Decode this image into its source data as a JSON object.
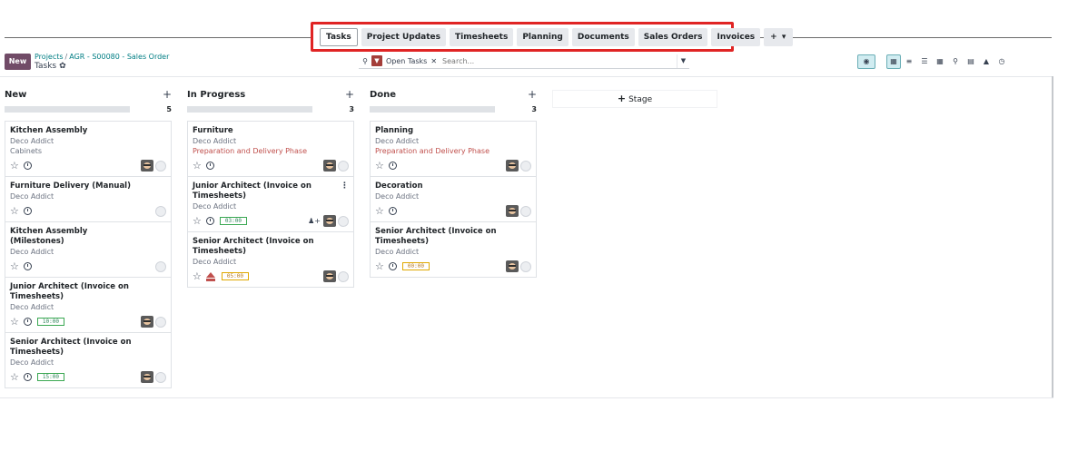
{
  "tabs": [
    {
      "label": "Tasks",
      "active": true
    },
    {
      "label": "Project Updates"
    },
    {
      "label": "Timesheets"
    },
    {
      "label": "Planning"
    },
    {
      "label": "Documents"
    },
    {
      "label": "Sales Orders"
    },
    {
      "label": "Invoices"
    },
    {
      "label": "+ ▾"
    }
  ],
  "control": {
    "new_label": "New",
    "breadcrumb_root": "Projects",
    "breadcrumb_sep": "/",
    "breadcrumb_current": "AGR - S00080 - Sales Order",
    "page_title": "Tasks",
    "gear": "✿"
  },
  "search": {
    "facet_label": "Open Tasks",
    "facet_remove": "✕",
    "placeholder": "Search...",
    "dropdown": "▼"
  },
  "views": [
    "▦",
    "≡",
    "☰",
    "▦",
    "⚲",
    "▤",
    "▲",
    "◷"
  ],
  "columns": [
    {
      "title": "New",
      "add": "+",
      "count": "5",
      "cards": [
        {
          "title": "Kitchen Assembly",
          "lines": [
            {
              "text": "Deco Addict"
            },
            {
              "text": "Cabinets"
            }
          ],
          "avatar": true,
          "badge": null
        },
        {
          "title": "Furniture Delivery (Manual)",
          "lines": [
            {
              "text": "Deco Addict"
            }
          ],
          "avatar": false,
          "badge": null
        },
        {
          "title": "Kitchen Assembly (Milestones)",
          "lines": [
            {
              "text": "Deco Addict"
            }
          ],
          "avatar": false,
          "badge": null
        },
        {
          "title": "Junior Architect (Invoice on Timesheets)",
          "lines": [
            {
              "text": "Deco Addict"
            }
          ],
          "avatar": true,
          "badge": "10:00"
        },
        {
          "title": "Senior Architect (Invoice on Timesheets)",
          "lines": [
            {
              "text": "Deco Addict"
            }
          ],
          "avatar": true,
          "badge": "15:00"
        }
      ]
    },
    {
      "title": "In Progress",
      "add": "+",
      "count": "3",
      "cards": [
        {
          "title": "Furniture",
          "lines": [
            {
              "text": "Deco Addict"
            },
            {
              "text": "Preparation and Delivery Phase",
              "red": true
            }
          ],
          "avatar": true,
          "badge": null
        },
        {
          "title": "Junior Architect (Invoice on Timesheets)",
          "lines": [
            {
              "text": "Deco Addict"
            }
          ],
          "avatar": true,
          "badge": "03:00",
          "kebab": true,
          "users": true
        },
        {
          "title": "Senior Architect (Invoice on Timesheets)",
          "lines": [
            {
              "text": "Deco Addict"
            }
          ],
          "avatar": true,
          "badge": "05:00",
          "badge_warn": true,
          "alert": true
        }
      ]
    },
    {
      "title": "Done",
      "add": "+",
      "count": "3",
      "cards": [
        {
          "title": "Planning",
          "lines": [
            {
              "text": "Deco Addict"
            },
            {
              "text": "Preparation and Delivery Phase",
              "red": true
            }
          ],
          "avatar": true,
          "badge": null
        },
        {
          "title": "Decoration",
          "lines": [
            {
              "text": "Deco Addict"
            }
          ],
          "avatar": true,
          "badge": null
        },
        {
          "title": "Senior Architect (Invoice on Timesheets)",
          "lines": [
            {
              "text": "Deco Addict"
            }
          ],
          "avatar": true,
          "badge": "00:00",
          "badge_warn": true
        }
      ]
    }
  ],
  "stage_add": {
    "icon": "+",
    "label": "Stage"
  }
}
